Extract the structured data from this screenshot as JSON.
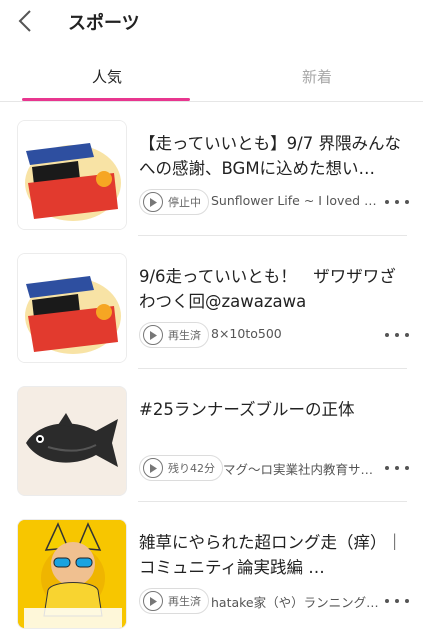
{
  "header": {
    "title": "スポーツ"
  },
  "tabs": [
    {
      "label": "人気"
    },
    {
      "label": "新着"
    }
  ],
  "colors": {
    "accent": "#e8368f"
  },
  "episodes": [
    {
      "title": "【走っていいとも】9/7 界隈みんなへの感謝、BGMに込めた想い…",
      "status": "停止中",
      "show": "Sunflower Life ~ I loved Ye…",
      "thumb": "hashitte-iitomo-logo"
    },
    {
      "title": "9/6走っていいとも！　ザワザワざわつく回@zawazawa",
      "status": "再生済",
      "show": "8×10to500",
      "thumb": "hashitte-iitomo-logo"
    },
    {
      "title": "#25ランナーズブルーの正体",
      "status": "残り42分",
      "show": "マグ〜ロ実業社内教育サ…",
      "thumb": "tuna-fish"
    },
    {
      "title": "雑草にやられた超ロング走（痒）｜コミュニティ論実践編 …",
      "status": "再生済",
      "show": "hatake家（や）ランニング…",
      "thumb": "hatake-avatar"
    }
  ]
}
